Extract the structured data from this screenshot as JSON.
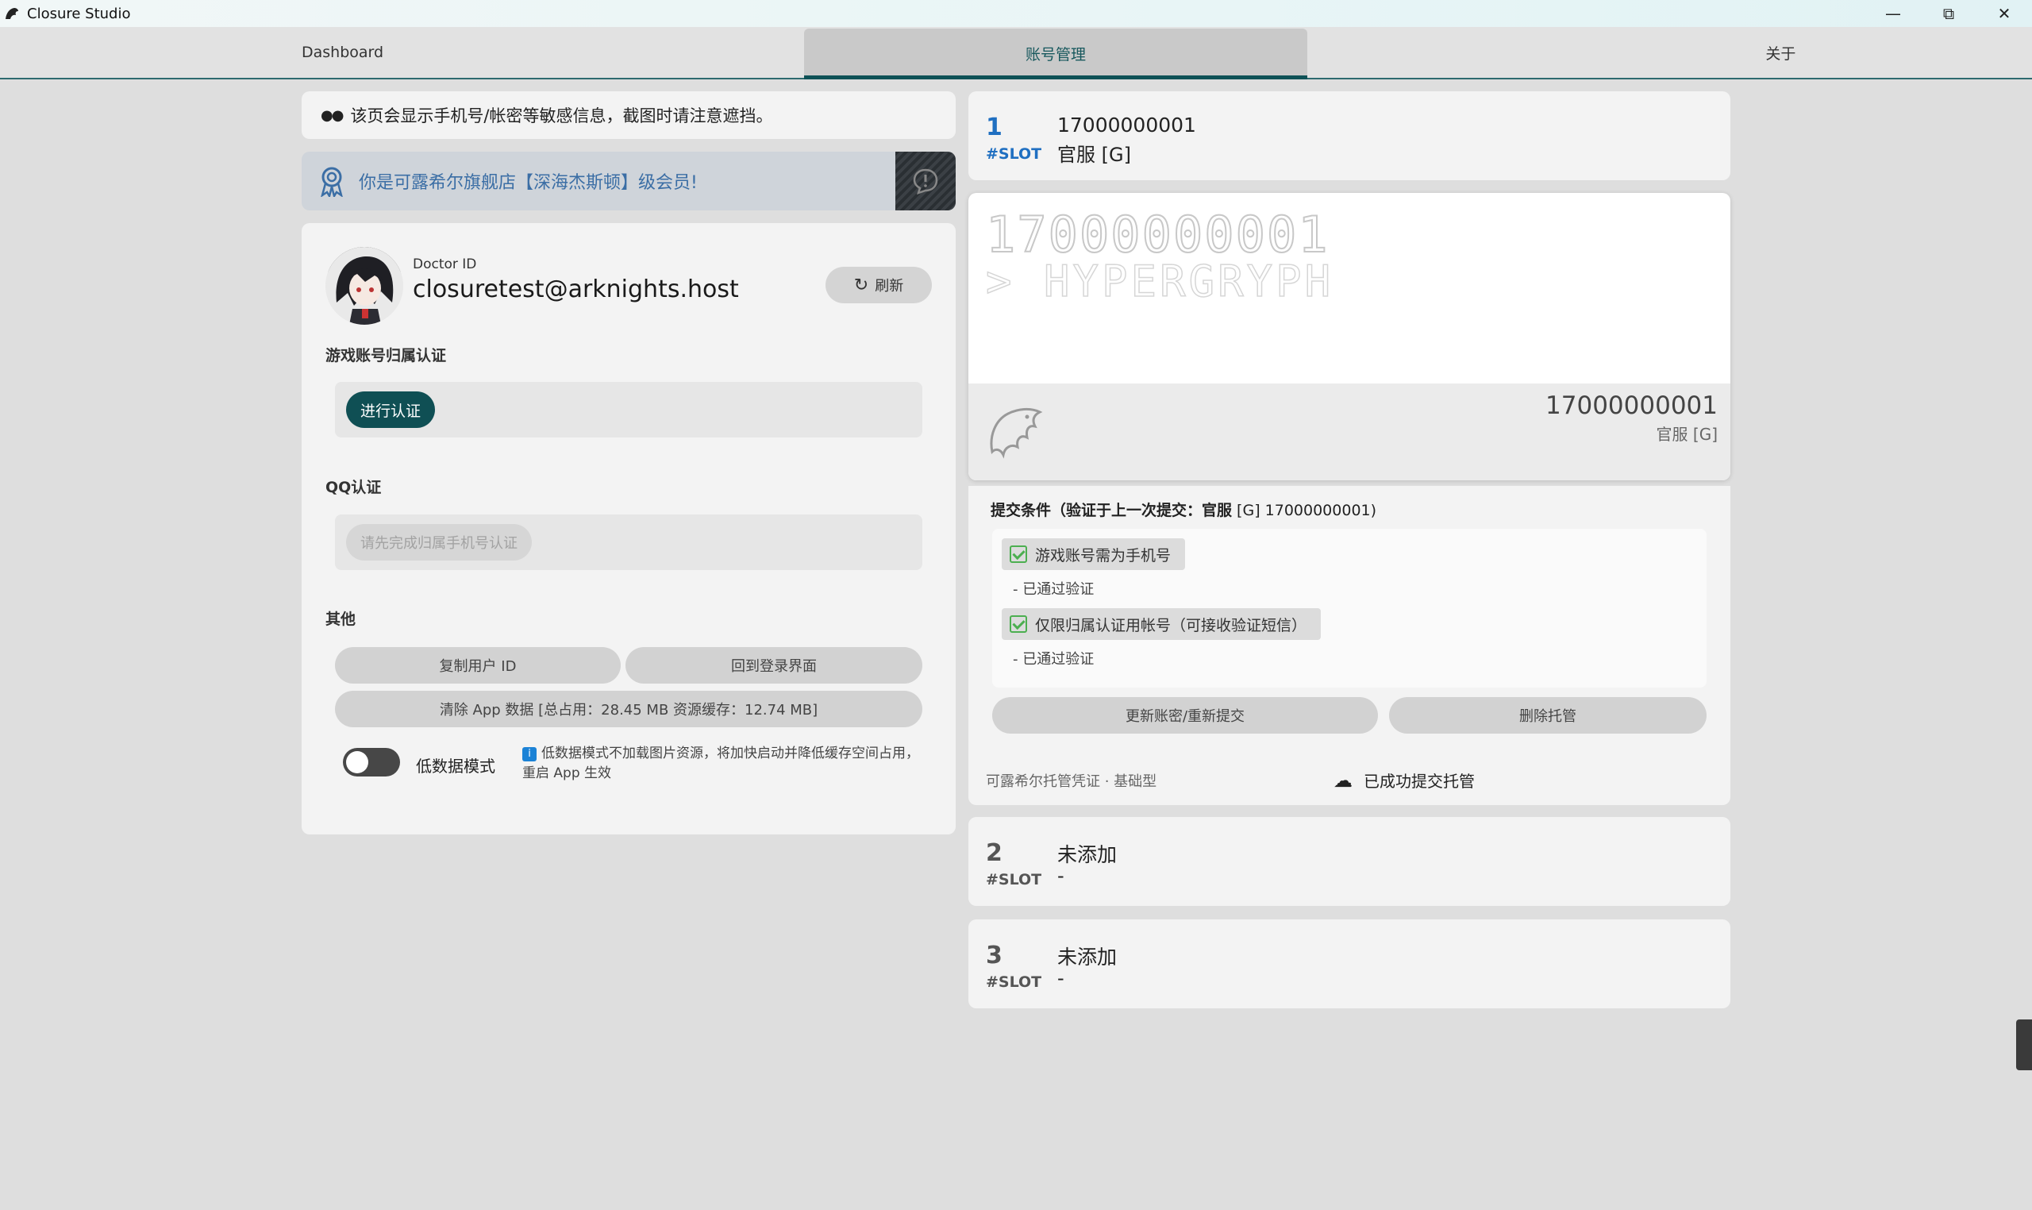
{
  "window": {
    "title": "Closure Studio"
  },
  "tabs": [
    {
      "label": "Dashboard",
      "active": false
    },
    {
      "label": "账号管理",
      "active": true
    },
    {
      "label": "关于",
      "active": false
    }
  ],
  "notice": {
    "text": "该页会显示手机号/帐密等敏感信息，截图时请注意遮挡。"
  },
  "member": {
    "text": "你是可露希尔旗舰店【深海杰斯顿】级会员!"
  },
  "profile": {
    "doctor_id_label": "Doctor ID",
    "doctor_id": "closuretest@arknights.host",
    "refresh_label": "刷新",
    "game_auth_title": "游戏账号归属认证",
    "verify_button": "进行认证",
    "qq_title": "QQ认证",
    "qq_button": "请先完成归属手机号认证",
    "other_title": "其他",
    "copy_id_button": "复制用户 ID",
    "back_login_button": "回到登录界面",
    "clear_data_button": "清除 App 数据 [总占用：28.45 MB 资源缓存：12.74 MB]",
    "low_data_label": "低数据模式",
    "low_data_note": "低数据模式不加载图片资源，将加快启动并降低缓存空间占用，重启 App 生效"
  },
  "slots": [
    {
      "num": "1",
      "tag": "#SLOT",
      "line1": "17000000001",
      "line2": "官服 [G]"
    },
    {
      "num": "2",
      "tag": "#SLOT",
      "line1": "未添加",
      "line2": "-"
    },
    {
      "num": "3",
      "tag": "#SLOT",
      "line1": "未添加",
      "line2": "-"
    }
  ],
  "slot_card": {
    "dot_phone": "17000000001",
    "dot_sub": "> HYPERGRYPH",
    "phone": "17000000001",
    "server": "官服 [G]"
  },
  "conditions": {
    "title_bold": "提交条件（验证于上一次提交：官服",
    "title_normal": " [G] 17000000001)",
    "items": [
      {
        "label": "游戏账号需为手机号",
        "note": "- 已通过验证"
      },
      {
        "label": "仅限归属认证用帐号（可接收验证短信）",
        "note": "- 已通过验证"
      }
    ],
    "update_button": "更新账密/重新提交",
    "delete_button": "删除托管",
    "footer_left": "可露希尔托管凭证 · 基础型",
    "footer_right": "已成功提交托管"
  },
  "colors": {
    "accent": "#0f4f54",
    "slot_blue": "#1f6fc1",
    "member_text": "#3b6ea5"
  }
}
